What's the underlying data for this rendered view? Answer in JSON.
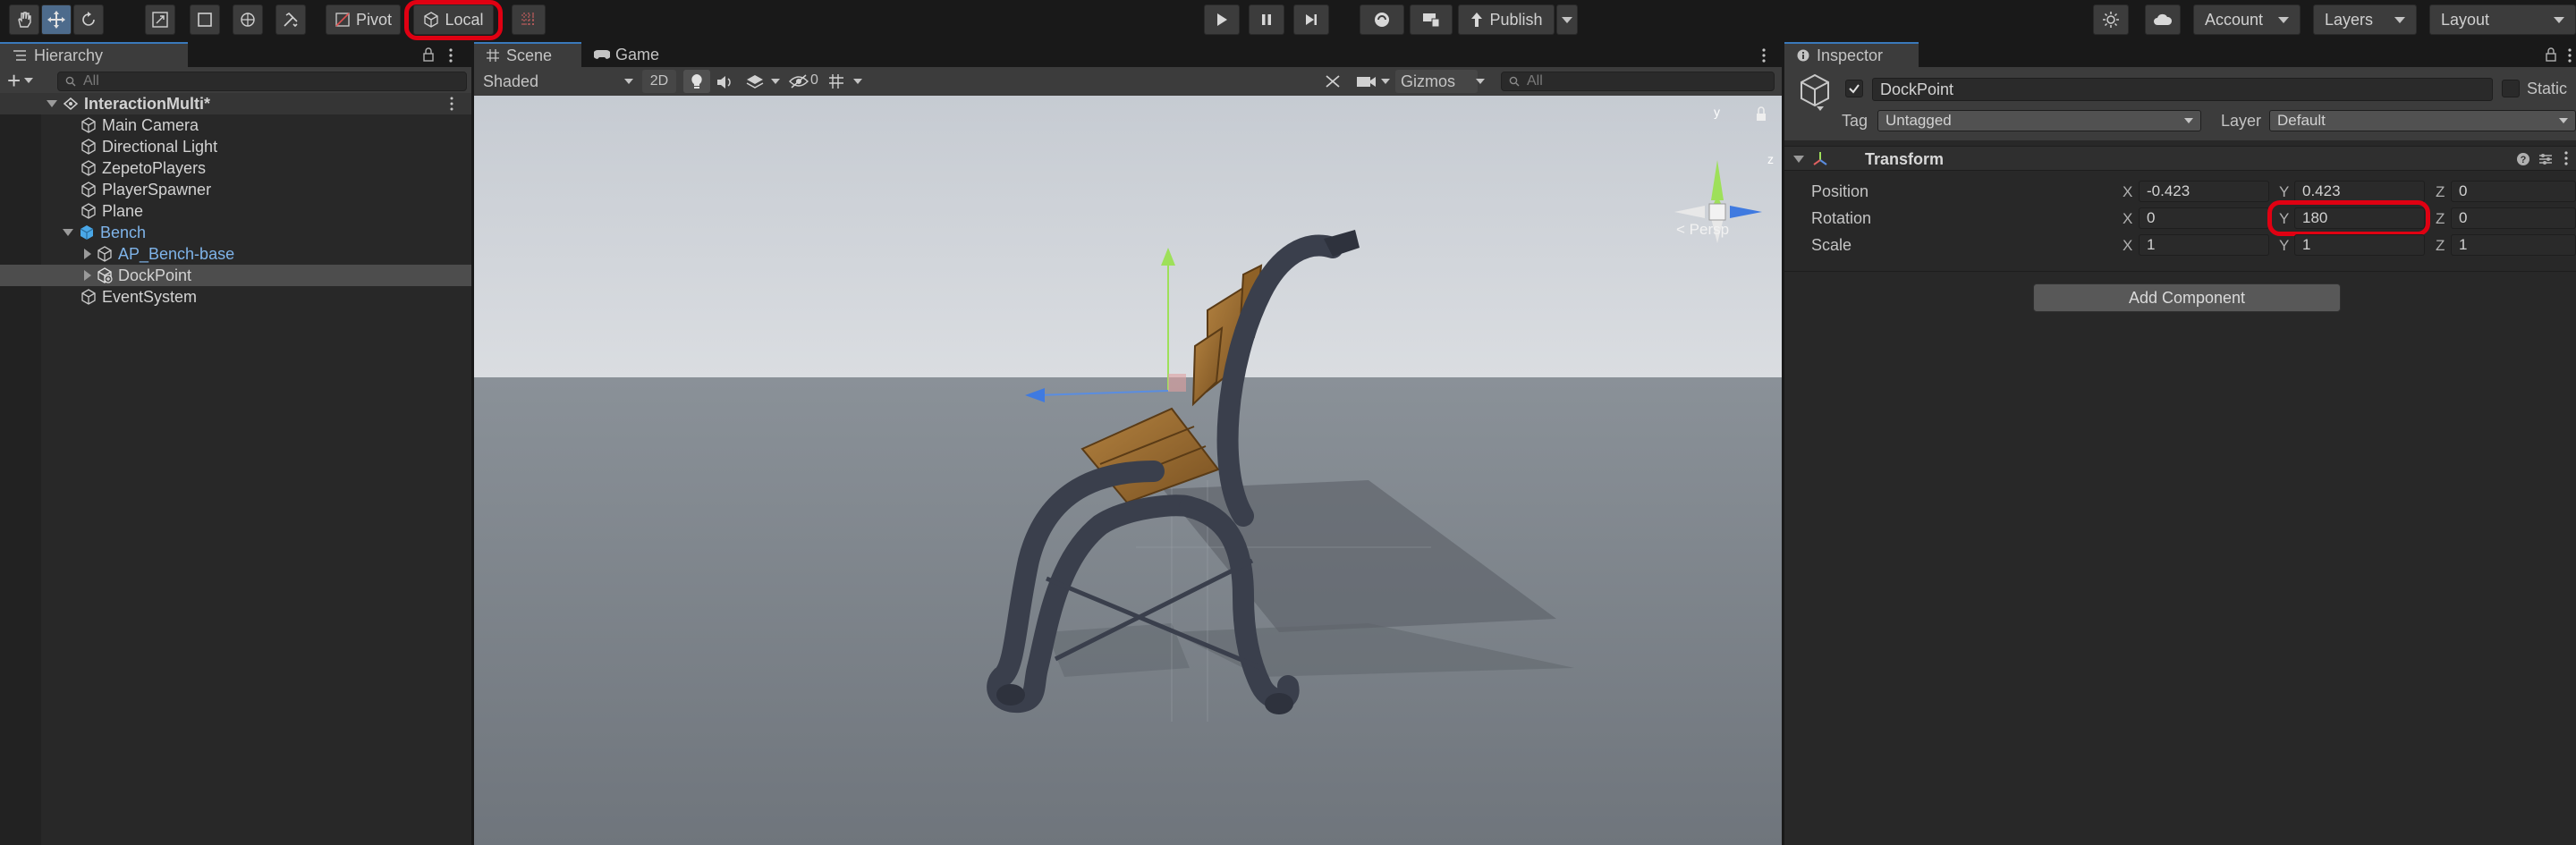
{
  "toolbar": {
    "pivot_label": "Pivot",
    "local_label": "Local",
    "publish_label": "Publish",
    "account_label": "Account",
    "layers_label": "Layers",
    "layout_label": "Layout"
  },
  "hierarchy": {
    "tab_label": "Hierarchy",
    "add_label": "+",
    "search_placeholder": "All",
    "items": [
      {
        "label": "InteractionMulti*"
      },
      {
        "label": "Main Camera"
      },
      {
        "label": "Directional Light"
      },
      {
        "label": "ZepetoPlayers"
      },
      {
        "label": "PlayerSpawner"
      },
      {
        "label": "Plane"
      },
      {
        "label": "Bench"
      },
      {
        "label": "AP_Bench-base"
      },
      {
        "label": "DockPoint"
      },
      {
        "label": "EventSystem"
      }
    ]
  },
  "scene": {
    "tab_scene": "Scene",
    "tab_game": "Game",
    "shading_mode": "Shaded",
    "mode_2d": "2D",
    "hidden_count": "0",
    "gizmos_label": "Gizmos",
    "search_placeholder": "All",
    "persp_label": "< Persp",
    "axis_y": "y",
    "axis_z": "z"
  },
  "inspector": {
    "tab_label": "Inspector",
    "object_name": "DockPoint",
    "static_label": "Static",
    "tag_label": "Tag",
    "tag_value": "Untagged",
    "layer_label": "Layer",
    "layer_value": "Default",
    "component_title": "Transform",
    "rows": [
      {
        "label": "Position",
        "x": "-0.423",
        "y": "0.423",
        "z": "0"
      },
      {
        "label": "Rotation",
        "x": "0",
        "y": "180",
        "z": "0"
      },
      {
        "label": "Scale",
        "x": "1",
        "y": "1",
        "z": "1"
      }
    ],
    "axis_x": "X",
    "axis_y": "Y",
    "axis_z": "Z",
    "add_component_label": "Add Component"
  }
}
